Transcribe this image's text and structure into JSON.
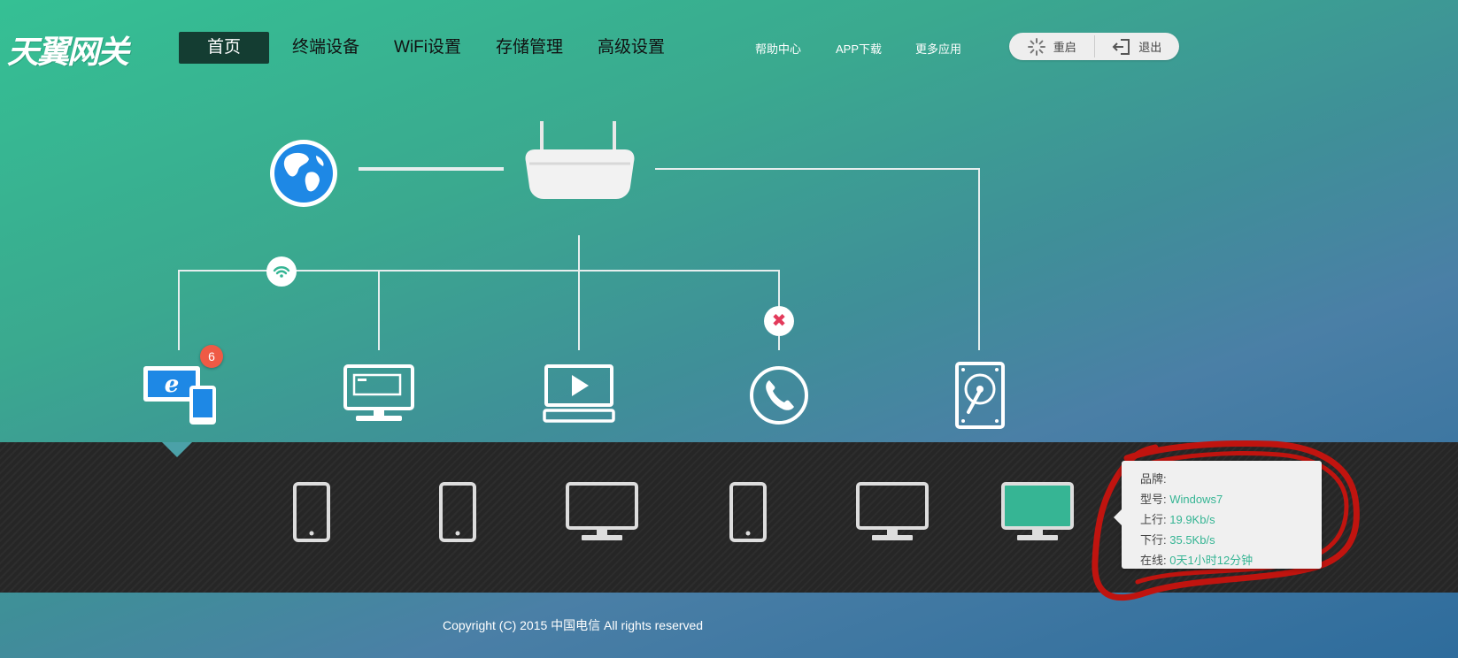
{
  "logo": "天翼网关",
  "nav": {
    "items": [
      {
        "label": "首页"
      },
      {
        "label": "终端设备"
      },
      {
        "label": "WiFi设置"
      },
      {
        "label": "存储管理"
      },
      {
        "label": "高级设置"
      }
    ]
  },
  "toplinks": {
    "help": "帮助中心",
    "app": "APP下载",
    "more": "更多应用"
  },
  "actions": {
    "restart": "重启",
    "logout": "退出"
  },
  "topology": {
    "badge_count": "6"
  },
  "devices": [
    "phone-icon",
    "phone-icon",
    "monitor-icon",
    "phone-icon",
    "monitor-icon",
    "monitor-icon-selected"
  ],
  "tooltip": {
    "brand_label": "品牌:",
    "brand_value": "",
    "model_label": "型号:",
    "model_value": "Windows7",
    "up_label": "上行:",
    "up_value": "19.9Kb/s",
    "down_label": "下行:",
    "down_value": "35.5Kb/s",
    "online_label": "在线:",
    "online_value": "0天1小时12分钟"
  },
  "footer": "Copyright (C) 2015 中国电信 All rights reserved",
  "colors": {
    "accent": "#36b594",
    "nav_active": "#143d32",
    "band": "#262626",
    "badge": "#ef5a45",
    "alert": "#e33a5b",
    "annotation": "#c0140f"
  }
}
